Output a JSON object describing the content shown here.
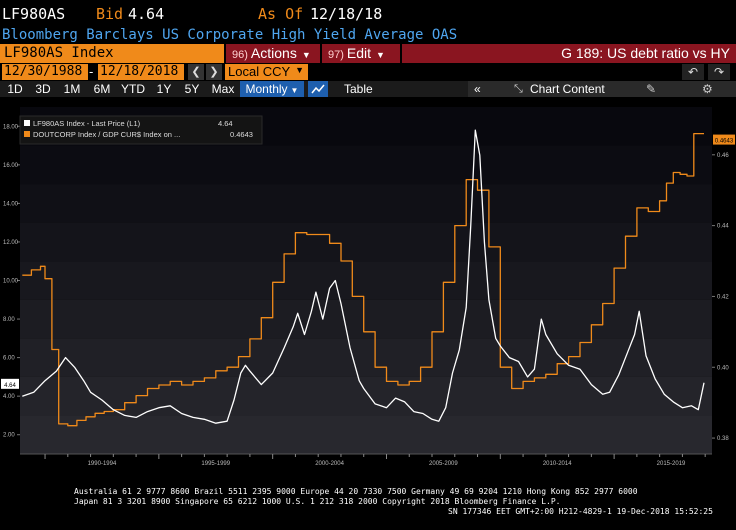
{
  "header": {
    "ticker": "LF980AS",
    "bid_label": "Bid",
    "bid_value": "4.64",
    "asof_label": "As Of",
    "asof_value": "12/18/18",
    "description": "Bloomberg Barclays US Corporate High Yield Average OAS"
  },
  "toolbar": {
    "security": "LF980AS Index",
    "actions_num": "96)",
    "actions_label": "Actions",
    "edit_num": "97)",
    "edit_label": "Edit",
    "graph_title": "G 189: US debt ratio vs HY"
  },
  "range": {
    "start_date": "12/30/1988",
    "separator": "-",
    "end_date": "12/18/2018",
    "currency": "Local CCY"
  },
  "periods": [
    "1D",
    "3D",
    "1M",
    "6M",
    "YTD",
    "1Y",
    "5Y",
    "Max"
  ],
  "frequency": "Monthly",
  "table_label": "Table",
  "chart_content_label": "Chart Content",
  "icons": {
    "prev": "chevron-left-icon",
    "next": "chevron-right-icon",
    "undo": "undo-icon",
    "redo": "redo-icon",
    "chart_type": "line-chart-icon",
    "collapse": "double-chevron-left-icon",
    "edit": "pencil-icon",
    "settings": "gear-icon"
  },
  "colors": {
    "background": "#000000",
    "series_white": "#ffffff",
    "series_orange": "#f08a1a",
    "accent_red": "#8a1520",
    "accent_blue": "#1e5fae"
  },
  "chart_data": {
    "type": "line",
    "x_tick_labels": [
      "1990-1994",
      "1995-1999",
      "2000-2004",
      "2005-2009",
      "2010-2014",
      "2015-2019"
    ],
    "xlim": [
      1988.9,
      2019.3
    ],
    "left_axis": {
      "ticks": [
        "18.00",
        "16.00",
        "14.00",
        "12.00",
        "10.00",
        "8.00",
        "6.00",
        "4.00",
        "2.00"
      ],
      "ylim": [
        1.0,
        19.0
      ]
    },
    "right_axis": {
      "ticks": [
        "0.46",
        "0.44",
        "0.42",
        "0.40",
        "0.38"
      ],
      "ylim": [
        0.3755,
        0.4735
      ]
    },
    "legend_position": "top-left",
    "series": [
      {
        "name": "LF980AS Index - Last Price (L1)",
        "last_value": "4.64",
        "axis": "left",
        "x": [
          1989.0,
          1989.5,
          1990.0,
          1990.5,
          1990.9,
          1991.3,
          1991.7,
          1992.0,
          1992.5,
          1993.0,
          1993.5,
          1994.0,
          1994.5,
          1995.0,
          1995.5,
          1996.0,
          1996.5,
          1997.0,
          1997.5,
          1998.0,
          1998.3,
          1998.6,
          1998.8,
          1999.0,
          1999.5,
          2000.0,
          2000.5,
          2000.9,
          2001.1,
          2001.4,
          2001.7,
          2001.9,
          2002.2,
          2002.5,
          2002.75,
          2003.0,
          2003.4,
          2003.8,
          2004.0,
          2004.5,
          2005.0,
          2005.4,
          2005.8,
          2006.2,
          2006.6,
          2007.0,
          2007.3,
          2007.6,
          2007.9,
          2008.2,
          2008.5,
          2008.7,
          2008.9,
          2009.1,
          2009.3,
          2009.5,
          2009.8,
          2010.0,
          2010.4,
          2010.8,
          2011.2,
          2011.5,
          2011.8,
          2012.0,
          2012.5,
          2013.0,
          2013.5,
          2014.0,
          2014.5,
          2014.8,
          2015.2,
          2015.6,
          2015.9,
          2016.1,
          2016.4,
          2016.8,
          2017.2,
          2017.6,
          2018.0,
          2018.4,
          2018.7,
          2018.95
        ],
        "y": [
          4.0,
          4.2,
          4.8,
          5.3,
          6.0,
          5.5,
          4.8,
          4.2,
          3.8,
          3.3,
          3.0,
          2.9,
          3.2,
          3.4,
          3.5,
          3.1,
          2.9,
          2.8,
          2.6,
          2.7,
          3.8,
          5.2,
          5.6,
          5.3,
          4.6,
          5.2,
          6.5,
          7.6,
          8.3,
          7.2,
          8.4,
          9.4,
          8.0,
          9.6,
          10.0,
          8.8,
          6.5,
          4.8,
          4.4,
          3.6,
          3.4,
          3.9,
          3.7,
          3.2,
          3.1,
          2.8,
          2.7,
          3.4,
          5.2,
          6.4,
          8.6,
          12.8,
          17.8,
          16.5,
          12.0,
          9.0,
          7.0,
          6.6,
          6.0,
          5.8,
          5.0,
          5.4,
          8.0,
          7.2,
          6.2,
          5.6,
          5.4,
          4.6,
          4.1,
          4.2,
          5.1,
          6.3,
          7.2,
          8.4,
          6.1,
          4.9,
          4.1,
          3.7,
          3.4,
          3.5,
          3.3,
          4.7
        ]
      },
      {
        "name": "DOUTCORP Index / GDP CUR$ Index on ...",
        "last_value": "0.4643",
        "axis": "right",
        "x": [
          1989.0,
          1989.4,
          1989.8,
          1990.0,
          1990.3,
          1990.6,
          1991.0,
          1991.4,
          1991.8,
          1992.2,
          1992.6,
          1993.0,
          1993.5,
          1994.0,
          1994.5,
          1995.0,
          1995.5,
          1996.0,
          1996.5,
          1997.0,
          1997.5,
          1998.0,
          1998.5,
          1999.0,
          1999.5,
          2000.0,
          2000.5,
          2001.0,
          2001.5,
          2002.0,
          2002.5,
          2003.0,
          2003.5,
          2004.0,
          2004.5,
          2005.0,
          2005.5,
          2006.0,
          2006.5,
          2007.0,
          2007.5,
          2008.0,
          2008.5,
          2009.0,
          2009.5,
          2010.0,
          2010.5,
          2011.0,
          2011.5,
          2012.0,
          2012.5,
          2013.0,
          2013.5,
          2014.0,
          2014.5,
          2015.0,
          2015.5,
          2016.0,
          2016.5,
          2017.0,
          2017.3,
          2017.6,
          2017.9,
          2018.2,
          2018.5,
          2018.95
        ],
        "y": [
          0.426,
          0.4275,
          0.4285,
          0.425,
          0.405,
          0.384,
          0.3835,
          0.385,
          0.386,
          0.387,
          0.3875,
          0.388,
          0.39,
          0.392,
          0.394,
          0.395,
          0.396,
          0.395,
          0.396,
          0.397,
          0.399,
          0.4,
          0.403,
          0.408,
          0.414,
          0.424,
          0.432,
          0.438,
          0.4375,
          0.4375,
          0.435,
          0.43,
          0.42,
          0.41,
          0.4,
          0.396,
          0.395,
          0.396,
          0.4,
          0.41,
          0.424,
          0.44,
          0.453,
          0.45,
          0.434,
          0.4,
          0.394,
          0.396,
          0.397,
          0.398,
          0.401,
          0.403,
          0.407,
          0.412,
          0.418,
          0.428,
          0.437,
          0.445,
          0.444,
          0.447,
          0.452,
          0.455,
          0.4545,
          0.454,
          0.466,
          0.466
        ]
      }
    ]
  },
  "footer": {
    "line1": "Australia 61 2 9777 8600 Brazil 5511 2395 9000 Europe 44 20 7330 7500 Germany 49 69 9204 1210 Hong Kong 852 2977 6000",
    "line2": "Japan 81 3 3201 8900        Singapore 65 6212 1000       U.S. 1 212 318 2000           Copyright 2018 Bloomberg Finance L.P.",
    "line3": "SN 177346 EET  GMT+2:00 H212-4829-1 19-Dec-2018 15:52:25"
  }
}
